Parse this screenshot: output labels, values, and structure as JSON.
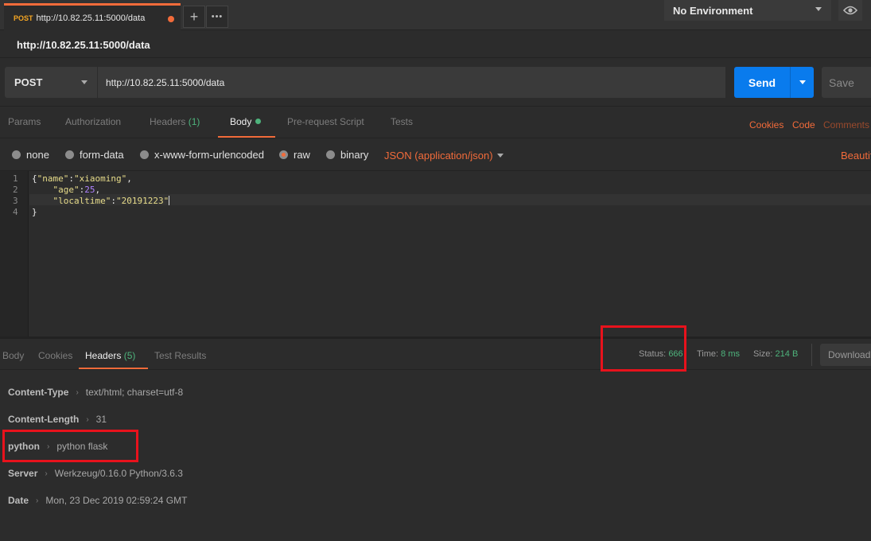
{
  "tab": {
    "method": "POST",
    "url": "http://10.82.25.11:5000/data"
  },
  "tab_buttons": {
    "new_tab": "+",
    "more": "•••"
  },
  "environment": {
    "selected": "No Environment"
  },
  "request": {
    "title": "http://10.82.25.11:5000/data",
    "method": "POST",
    "url": "http://10.82.25.11:5000/data",
    "send_label": "Send",
    "save_label": "Save"
  },
  "request_tabs": {
    "params": "Params",
    "authorization": "Authorization",
    "headers": "Headers",
    "headers_count": "(1)",
    "body": "Body",
    "pre_request": "Pre-request Script",
    "tests": "Tests",
    "cookies": "Cookies",
    "code": "Code",
    "comments": "Comments"
  },
  "body_types": {
    "none": "none",
    "form_data": "form-data",
    "urlencoded": "x-www-form-urlencoded",
    "raw": "raw",
    "binary": "binary",
    "content_type": "JSON (application/json)",
    "beautify": "Beautify"
  },
  "editor": {
    "line_numbers": [
      "1",
      "2",
      "3",
      "4"
    ],
    "lines": [
      {
        "open": "{",
        "key": "\"name\"",
        "colon": ":",
        "value": "\"xiaoming\"",
        "end": ","
      },
      {
        "indent": "    ",
        "key": "\"age\"",
        "colon": ":",
        "value": "25",
        "end": ","
      },
      {
        "indent": "    ",
        "key": "\"localtime\"",
        "colon": ":",
        "value": "\"20191223\"",
        "end": ""
      },
      {
        "close": "}"
      }
    ]
  },
  "response_tabs": {
    "body": "Body",
    "cookies": "Cookies",
    "headers": "Headers",
    "headers_count": "(5)",
    "test_results": "Test Results"
  },
  "response_meta": {
    "status_label": "Status:",
    "status_value": "666",
    "time_label": "Time:",
    "time_value": "8 ms",
    "size_label": "Size:",
    "size_value": "214 B",
    "download_label": "Download"
  },
  "response_headers": [
    {
      "key": "Content-Type",
      "value": "text/html; charset=utf-8"
    },
    {
      "key": "Content-Length",
      "value": "31"
    },
    {
      "key": "python",
      "value": "python flask"
    },
    {
      "key": "Server",
      "value": "Werkzeug/0.16.0 Python/3.6.3"
    },
    {
      "key": "Date",
      "value": "Mon, 23 Dec 2019 02:59:24 GMT"
    }
  ],
  "colors": {
    "accent_orange": "#f26b3a",
    "send_blue": "#097bed",
    "success_green": "#4eb37c",
    "annotation_red": "#e8121c"
  }
}
